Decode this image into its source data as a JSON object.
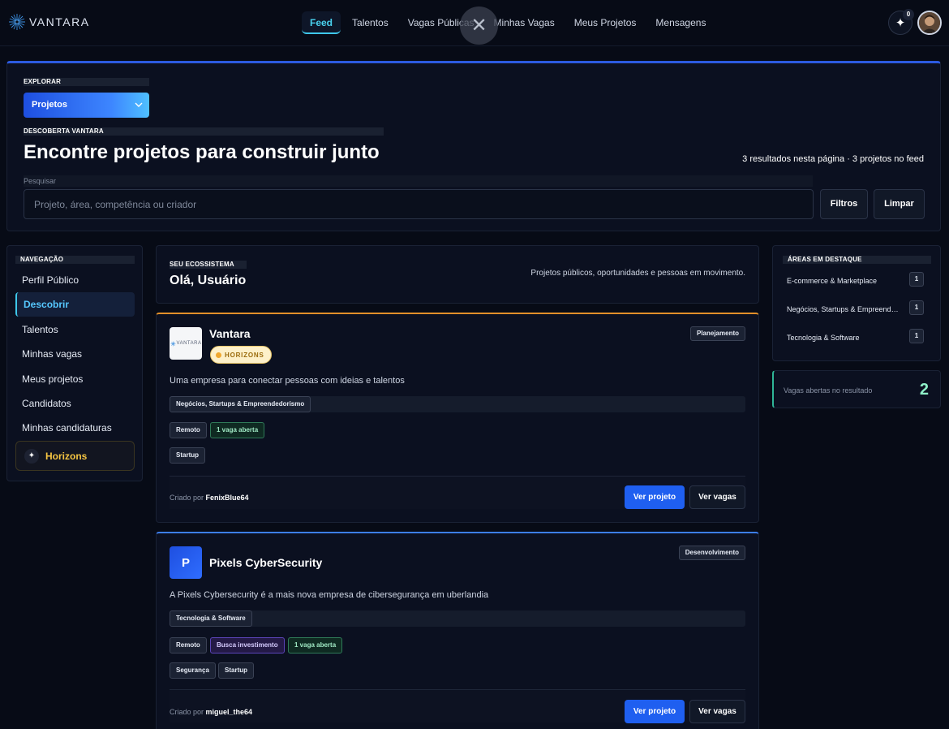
{
  "brand": {
    "name": "VANTARA"
  },
  "nav": {
    "items": [
      {
        "label": "Feed",
        "active": true
      },
      {
        "label": "Talentos"
      },
      {
        "label": "Vagas Públicas"
      },
      {
        "label": "Minhas Vagas"
      },
      {
        "label": "Meus Projetos"
      },
      {
        "label": "Mensagens"
      }
    ]
  },
  "header": {
    "notif_count": "0"
  },
  "explore": {
    "label": "EXPLORAR",
    "selected": "Projetos",
    "section_label": "DESCOBERTA VANTARA",
    "title": "Encontre projetos para construir junto",
    "results": "3 resultados nesta página · 3 projetos no feed",
    "search_label": "Pesquisar",
    "search_placeholder": "Projeto, área, competência ou criador",
    "filters_label": "Filtros",
    "clear_label": "Limpar"
  },
  "sidebar": {
    "title": "NAVEGAÇÃO",
    "items": [
      {
        "label": "Perfil Público"
      },
      {
        "label": "Descobrir",
        "active": true
      },
      {
        "label": "Talentos"
      },
      {
        "label": "Minhas vagas"
      },
      {
        "label": "Meus projetos"
      },
      {
        "label": "Candidatos"
      },
      {
        "label": "Minhas candidaturas"
      }
    ],
    "horizons_label": "Horizons"
  },
  "welcome": {
    "label": "SEU ECOSSISTEMA",
    "title": "Olá, Usuário",
    "subtitle": "Projetos públicos, oportunidades e pessoas em movimento."
  },
  "projects": [
    {
      "name": "Vantara",
      "logo_text": "VANTARA",
      "badge": "HORIZONS",
      "status": "Planejamento",
      "description": "Uma empresa para conectar pessoas com ideias e talentos",
      "category": "Negócios, Startups & Empreendedorismo",
      "tags_row1": [
        "Remoto",
        "1 vaga aberta"
      ],
      "tags_row2": [
        "Startup"
      ],
      "created_by_prefix": "Criado por",
      "creator": "FenixBlue64",
      "view_project": "Ver projeto",
      "view_jobs": "Ver vagas"
    },
    {
      "name": "Pixels CyberSecurity",
      "logo_letter": "P",
      "status": "Desenvolvimento",
      "description": "A Pixels Cybersecurity é a mais nova empresa de cibersegurança em uberlandia",
      "category": "Tecnologia & Software",
      "tags_row1": [
        "Remoto",
        "Busca investimento",
        "1 vaga aberta"
      ],
      "tags_row2": [
        "Segurança",
        "Startup"
      ],
      "created_by_prefix": "Criado por",
      "creator": "miguel_the64",
      "view_project": "Ver projeto",
      "view_jobs": "Ver vagas"
    }
  ],
  "areas": {
    "title": "ÁREAS EM DESTAQUE",
    "items": [
      {
        "label": "E-commerce & Marketplace",
        "count": "1"
      },
      {
        "label": "Negócios, Startups & Empreendedorismo",
        "count": "1"
      },
      {
        "label": "Tecnologia & Software",
        "count": "1"
      }
    ]
  },
  "open_jobs": {
    "label": "Vagas abertas no resultado",
    "value": "2"
  },
  "colors": {
    "accent": "#3ec7ea",
    "primary": "#1f5ff0",
    "horizons_gold": "#f5c542",
    "success": "#8ff0c8"
  }
}
